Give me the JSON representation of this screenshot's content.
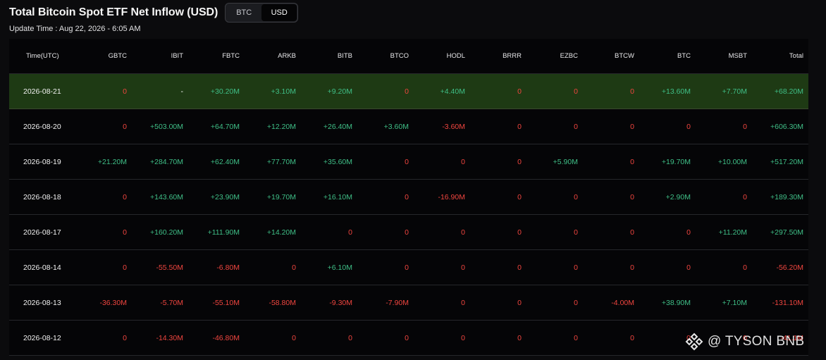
{
  "page": {
    "title": "Total Bitcoin Spot ETF Net Inflow (USD)",
    "update_time": "Update Time : Aug 22, 2026 - 6:05 AM",
    "toggle": {
      "options": [
        "BTC",
        "USD"
      ],
      "selected": "USD"
    }
  },
  "colors": {
    "positive": "#3fbf87",
    "negative": "#f0453f",
    "highlight_row": "#1e3a14",
    "background": "#0b0b0d"
  },
  "table": {
    "columns": [
      "Time(UTC)",
      "GBTC",
      "IBIT",
      "FBTC",
      "ARKB",
      "BITB",
      "BTCO",
      "HODL",
      "BRRR",
      "EZBC",
      "BTCW",
      "BTC",
      "MSBT",
      "Total"
    ],
    "rows": [
      {
        "date": "2026-08-21",
        "values": [
          "0",
          "-",
          "+30.20M",
          "+3.10M",
          "+9.20M",
          "0",
          "+4.40M",
          "0",
          "0",
          "0",
          "+13.60M",
          "+7.70M",
          "+68.20M"
        ]
      },
      {
        "date": "2026-08-20",
        "values": [
          "0",
          "+503.00M",
          "+64.70M",
          "+12.20M",
          "+26.40M",
          "+3.60M",
          "-3.60M",
          "0",
          "0",
          "0",
          "0",
          "0",
          "+606.30M"
        ]
      },
      {
        "date": "2026-08-19",
        "values": [
          "+21.20M",
          "+284.70M",
          "+62.40M",
          "+77.70M",
          "+35.60M",
          "0",
          "0",
          "0",
          "+5.90M",
          "0",
          "+19.70M",
          "+10.00M",
          "+517.20M"
        ]
      },
      {
        "date": "2026-08-18",
        "values": [
          "0",
          "+143.60M",
          "+23.90M",
          "+19.70M",
          "+16.10M",
          "0",
          "-16.90M",
          "0",
          "0",
          "0",
          "+2.90M",
          "0",
          "+189.30M"
        ]
      },
      {
        "date": "2026-08-17",
        "values": [
          "0",
          "+160.20M",
          "+111.90M",
          "+14.20M",
          "0",
          "0",
          "0",
          "0",
          "0",
          "0",
          "0",
          "+11.20M",
          "+297.50M"
        ]
      },
      {
        "date": "2026-08-14",
        "values": [
          "0",
          "-55.50M",
          "-6.80M",
          "0",
          "+6.10M",
          "0",
          "0",
          "0",
          "0",
          "0",
          "0",
          "0",
          "-56.20M"
        ]
      },
      {
        "date": "2026-08-13",
        "values": [
          "-36.30M",
          "-5.70M",
          "-55.10M",
          "-58.80M",
          "-9.30M",
          "-7.90M",
          "0",
          "0",
          "0",
          "-4.00M",
          "+38.90M",
          "+7.10M",
          "-131.10M"
        ]
      },
      {
        "date": "2026-08-12",
        "values": [
          "0",
          "-14.30M",
          "-46.80M",
          "0",
          "0",
          "0",
          "0",
          "0",
          "0",
          "0",
          "0",
          "0",
          "-41.1M"
        ]
      }
    ]
  },
  "watermark": {
    "text": "@ TYSON BNB",
    "icon": "binance-logo-icon"
  }
}
